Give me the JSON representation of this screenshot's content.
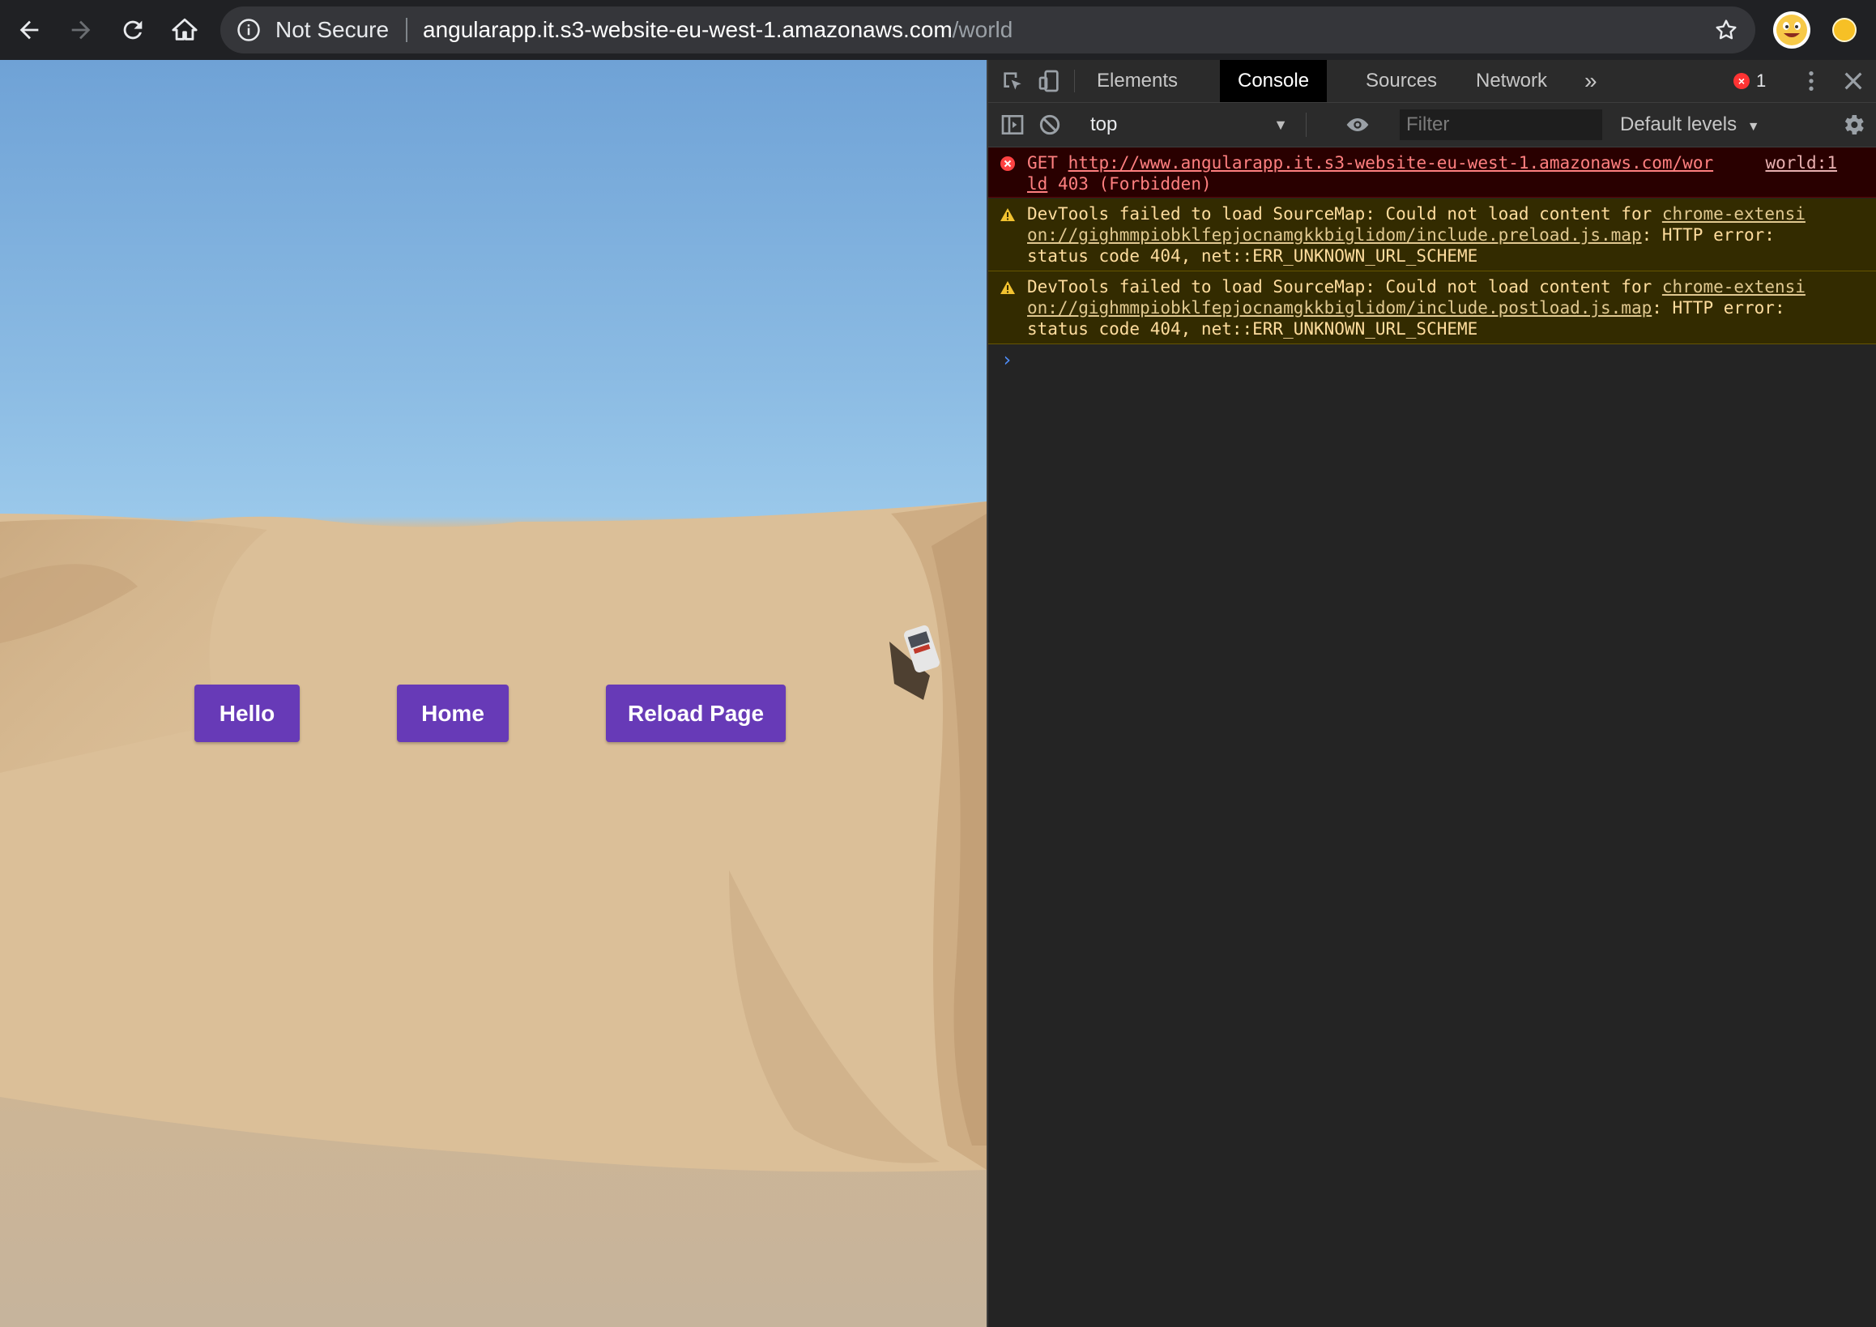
{
  "browser": {
    "security_label": "Not Secure",
    "url_host": "angularapp.it.s3-website-eu-west-1.amazonaws.com",
    "url_path": "/world"
  },
  "page": {
    "buttons": {
      "hello": "Hello",
      "home": "Home",
      "reload": "Reload Page"
    },
    "accent_color": "#673ab7"
  },
  "devtools": {
    "tabs": [
      "Elements",
      "Console",
      "Sources",
      "Network"
    ],
    "active_tab": "Console",
    "more_tabs_glyph": "»",
    "error_count": "1",
    "context": "top",
    "filter_placeholder": "Filter",
    "levels": "Default levels",
    "messages": [
      {
        "level": "error",
        "method": "GET",
        "url": "http://www.angularapp.it.s3-website-eu-west-1.amazonaws.com/wor",
        "url_cont": "ld",
        "status": "403 (Forbidden)",
        "source": "world:1"
      },
      {
        "level": "warning",
        "prefix": "DevTools failed to load SourceMap: Could not load content for",
        "link_line1": "chrome-extensi",
        "link_line2": "on://gighmmpiobklfepjocnamgkkbiglidom/include.preload.js.map",
        "suffix1": ": HTTP error:",
        "suffix2": "status code 404, net::ERR_UNKNOWN_URL_SCHEME"
      },
      {
        "level": "warning",
        "prefix": "DevTools failed to load SourceMap: Could not load content for",
        "link_line1": "chrome-extensi",
        "link_line2": "on://gighmmpiobklfepjocnamgkkbiglidom/include.postload.js.map",
        "suffix1": ": HTTP error:",
        "suffix2": "status code 404, net::ERR_UNKNOWN_URL_SCHEME"
      }
    ],
    "prompt_glyph": "›"
  }
}
